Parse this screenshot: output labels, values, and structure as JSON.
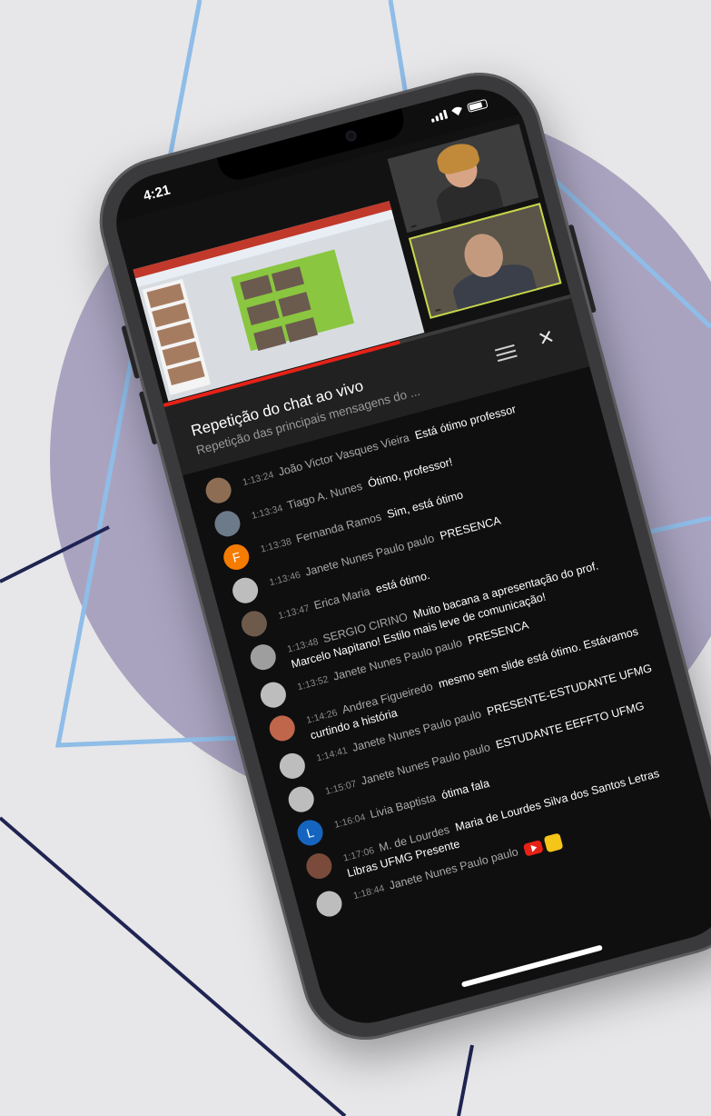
{
  "status": {
    "time": "4:21"
  },
  "player": {
    "presenter_label": "",
    "participant_label": ""
  },
  "chat": {
    "title": "Repetição do chat ao vivo",
    "subtitle": "Repetição das principais mensagens do ...",
    "messages": [
      {
        "time": "1:13:24",
        "author": "João Victor Vasques Vieira",
        "text": "Está ótimo professor",
        "avatar_color": "#8d6e55",
        "initial": ""
      },
      {
        "time": "1:13:34",
        "author": "Tiago A. Nunes",
        "text": "Ótimo, professor!",
        "avatar_color": "#6c7a89",
        "initial": ""
      },
      {
        "time": "1:13:38",
        "author": "Fernanda Ramos",
        "text": "Sim, está ótimo",
        "avatar_color": "#f57c00",
        "initial": "F"
      },
      {
        "time": "1:13:46",
        "author": "Janete Nunes Paulo paulo",
        "text": "PRESENCA",
        "avatar_color": "#bdbdbd",
        "initial": ""
      },
      {
        "time": "1:13:47",
        "author": "Erica Maria",
        "text": "está ótimo.",
        "avatar_color": "#6e5a4b",
        "initial": ""
      },
      {
        "time": "1:13:48",
        "author": "SERGIO CIRINO",
        "text": "Muito bacana a apresentação do prof. Marcelo Napitano! Estilo mais leve de comunicação!",
        "avatar_color": "#9e9e9e",
        "initial": ""
      },
      {
        "time": "1:13:52",
        "author": "Janete Nunes Paulo paulo",
        "text": "PRESENCA",
        "avatar_color": "#bdbdbd",
        "initial": ""
      },
      {
        "time": "1:14:26",
        "author": "Andrea Figueiredo",
        "text": "mesmo sem slide está ótimo. Estávamos curtindo a história",
        "avatar_color": "#c0664a",
        "initial": ""
      },
      {
        "time": "1:14:41",
        "author": "Janete Nunes Paulo paulo",
        "text": "PRESENTE-ESTUDANTE UFMG",
        "avatar_color": "#bdbdbd",
        "initial": ""
      },
      {
        "time": "1:15:07",
        "author": "Janete Nunes Paulo paulo",
        "text": "ESTUDANTE EEFFTO UFMG",
        "avatar_color": "#bdbdbd",
        "initial": ""
      },
      {
        "time": "1:16:04",
        "author": "Livia Baptista",
        "text": "ótima fala",
        "avatar_color": "#1565c0",
        "initial": "L"
      },
      {
        "time": "1:17:06",
        "author": "M. de Lourdes",
        "text": "Maria de Lourdes Silva dos Santos Letras Libras UFMG Presente",
        "avatar_color": "#7a4b3a",
        "initial": ""
      },
      {
        "time": "1:18:44",
        "author": "Janete Nunes Paulo paulo",
        "text": "",
        "avatar_color": "#bdbdbd",
        "initial": "",
        "emoji": [
          "youtube-icon",
          "raised-hand-icon"
        ]
      }
    ]
  },
  "colors": {
    "accent_red": "#e62117",
    "background_shape": "#a9a3c0",
    "line_light": "#8fbde8",
    "line_dark": "#1f2452"
  }
}
